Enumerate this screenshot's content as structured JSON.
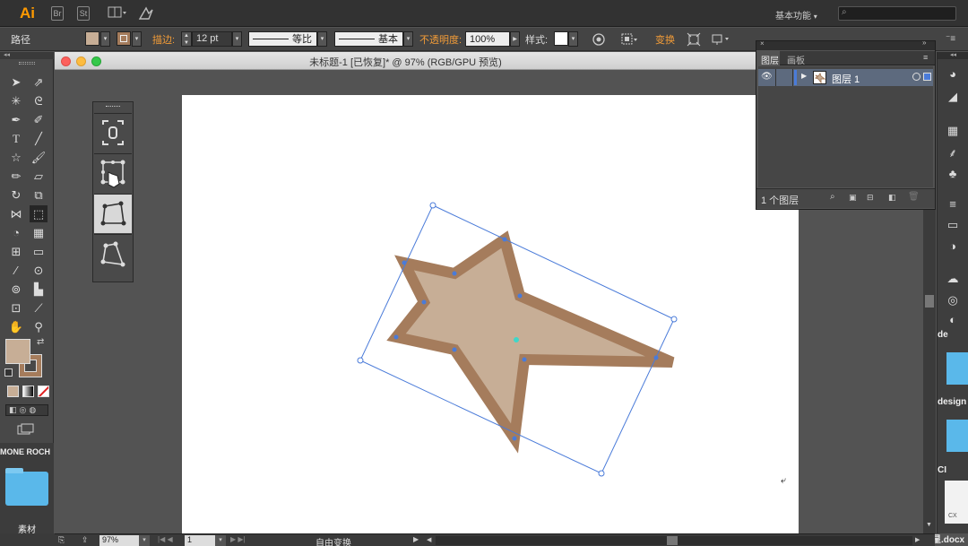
{
  "app": {
    "logo": "Ai",
    "buttons": [
      "Br",
      "St"
    ],
    "workspace": "基本功能",
    "search_placeholder": ""
  },
  "control_bar": {
    "object_type": "路径",
    "stroke_label": "描边:",
    "stroke_weight": "12 pt",
    "profile_label": "等比",
    "brush_label": "基本",
    "opacity_label": "不透明度:",
    "opacity_value": "100%",
    "style_label": "样式:",
    "transform_label": "变换"
  },
  "document": {
    "title": "未标题-1 [已恢复]* @ 97% (RGB/GPU 预览)"
  },
  "layers_panel": {
    "tabs": [
      "图层",
      "画板"
    ],
    "layer_name": "图层 1",
    "layer_count": "1 个图层"
  },
  "status_bar": {
    "zoom": "97%",
    "artboard_number": "1",
    "tool_status": "自由变换"
  },
  "desktop": {
    "left_label_top": "MONE ROCH",
    "left_folder_label": "素材",
    "right_label_1": "de",
    "right_label_2": "design",
    "right_label_3": "CI",
    "right_file": "星.docx",
    "right_file_ext": "CX"
  },
  "colors": {
    "fill": "#c7ae96",
    "stroke": "#a57c5c",
    "selection": "#4a7bd9",
    "accent": "#f29c38"
  }
}
